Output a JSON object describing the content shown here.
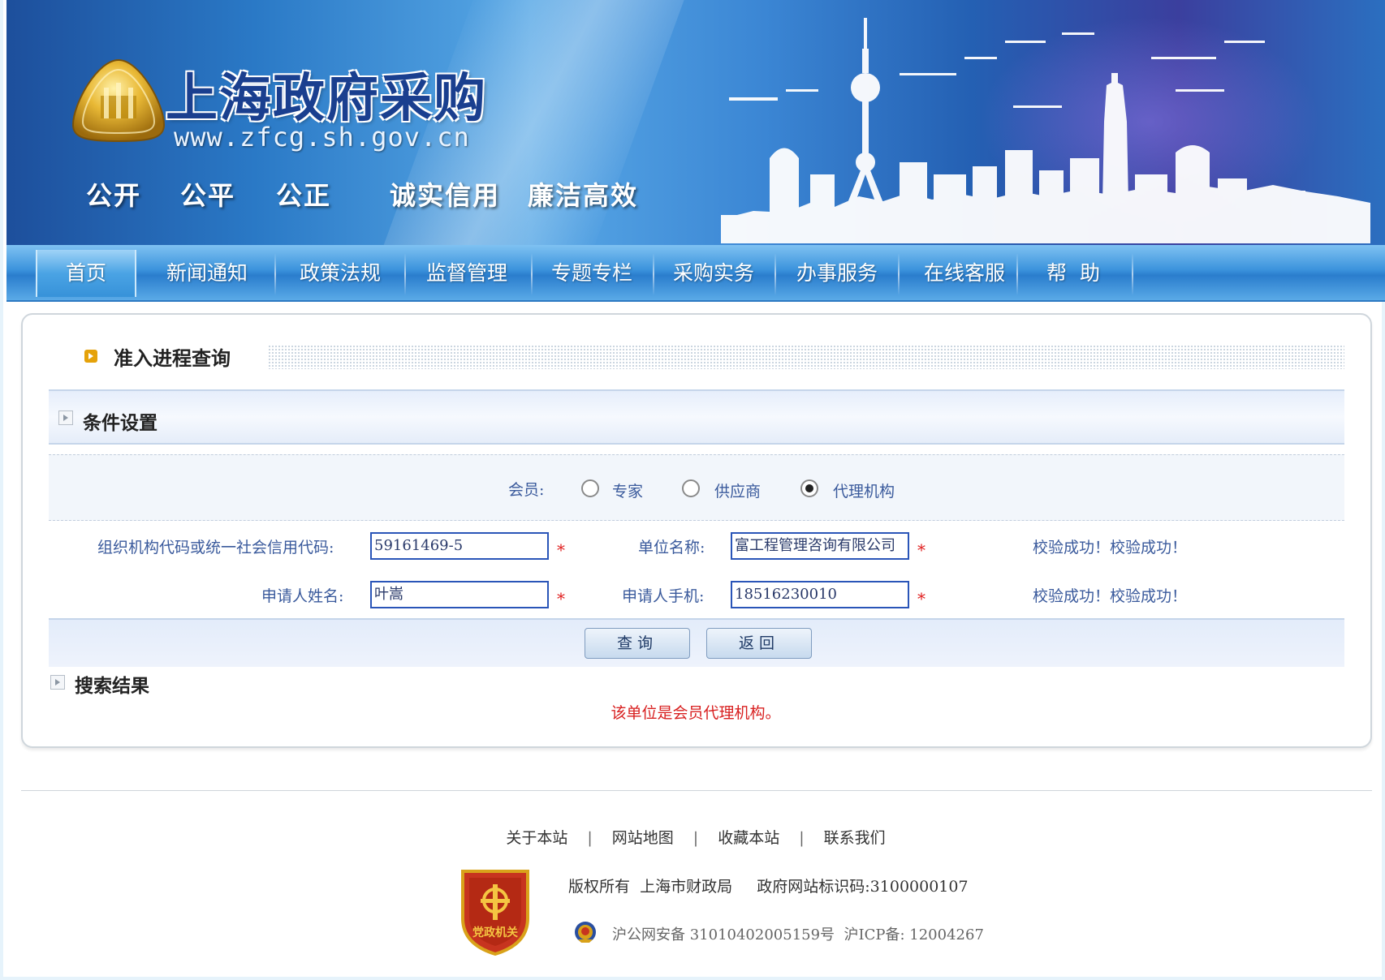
{
  "header": {
    "site_title": "上海政府采购",
    "site_url": "www.zfcg.sh.gov.cn",
    "slogans": [
      "公开",
      "公平",
      "公正",
      "诚实信用",
      "廉洁高效"
    ]
  },
  "nav": {
    "items": [
      "首页",
      "新闻通知",
      "政策法规",
      "监督管理",
      "专题专栏",
      "采购实务",
      "办事服务",
      "在线客服",
      "帮  助"
    ]
  },
  "page": {
    "title": "准入进程查询"
  },
  "conditions": {
    "section_title": "条件设置",
    "member_label": "会员:",
    "member_options": [
      {
        "label": "专家",
        "checked": false
      },
      {
        "label": "供应商",
        "checked": false
      },
      {
        "label": "代理机构",
        "checked": true
      }
    ],
    "org_code_label": "组织机构代码或统一社会信用代码:",
    "org_code_value": "59161469-5",
    "unit_name_label": "单位名称:",
    "unit_name_value": "富工程管理咨询有限公司",
    "applicant_name_label": "申请人姓名:",
    "applicant_name_value": "叶嵩",
    "applicant_phone_label": "申请人手机:",
    "applicant_phone_value": "18516230010",
    "required_mark": "*",
    "validation_row1": "校验成功！校验成功！",
    "validation_row2": "校验成功！校验成功！",
    "query_button": "查询",
    "back_button": "返回"
  },
  "results": {
    "section_title": "搜索结果",
    "message": "该单位是会员代理机构。"
  },
  "footer": {
    "links": [
      "关于本站",
      "网站地图",
      "收藏本站",
      "联系我们"
    ],
    "copyright": "版权所有  上海市财政局     政府网站标识码:3100000107",
    "beian": "沪公网安备 31010402005159号  沪ICP备: 12004267",
    "badge_text": "党政机关"
  },
  "colors": {
    "banner_blue": "#2a79c6",
    "nav_blue": "#3b93dc",
    "label_blue": "#3a5a9c",
    "error_red": "#d82020",
    "input_border": "#2a55b8"
  }
}
